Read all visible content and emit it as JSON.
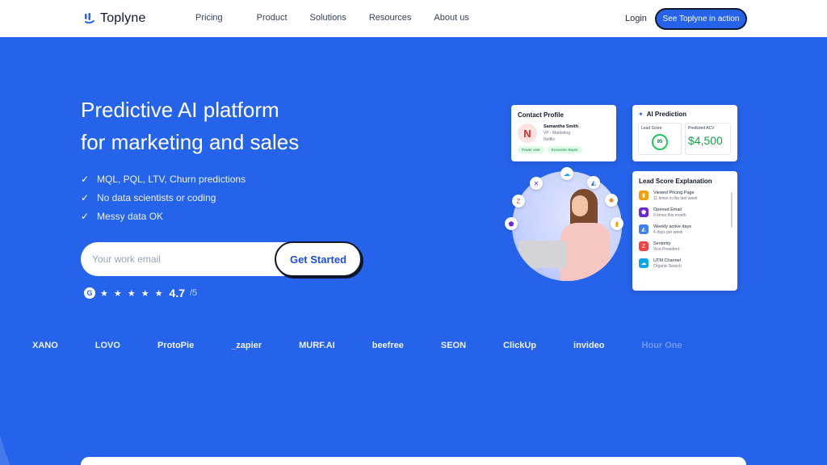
{
  "nav": {
    "logo_text": "Toplyne",
    "links": [
      "Pricing",
      "Product",
      "Solutions",
      "Resources",
      "About us"
    ],
    "login": "Login",
    "cta": "See Toplyne in action"
  },
  "hero": {
    "title_line1": "Predictive AI platform",
    "title_line2": "for marketing and sales",
    "checks": [
      "MQL, PQL, LTV, Churn predictions",
      "No data scientists or coding",
      "Messy data OK"
    ],
    "email_placeholder": "Your work email",
    "cta": "Get Started",
    "rating_badge": "G",
    "stars": "★ ★ ★ ★ ★",
    "score": "4.7",
    "score_denom": "/5"
  },
  "contact_card": {
    "title": "Contact Profile",
    "avatar_letter": "N",
    "name": "Samantha Smith",
    "role": "VP - Marketing",
    "company": "Netflix",
    "tags": [
      "Power user",
      "Economic Buyer"
    ]
  },
  "prediction_card": {
    "title": "AI Prediction",
    "lead_score_label": "Lead Score",
    "lead_score": "95",
    "acv_label": "Predicted ACV",
    "acv": "$4,500"
  },
  "lead_explanation": {
    "title": "Lead Score Explanation",
    "items": [
      {
        "title": "Viewed Pricing Page",
        "sub": "11 times in the last week",
        "color": "#f59e0b"
      },
      {
        "title": "Opened Email",
        "sub": "6 times this month",
        "color": "#6d28d9"
      },
      {
        "title": "Weekly active days",
        "sub": "4 days per week",
        "color": "#3b82f6"
      },
      {
        "title": "Seniority",
        "sub": "Vice President",
        "color": "#ef4444"
      },
      {
        "title": "UTM Channel",
        "sub": "Organic Search",
        "color": "#0ea5e9"
      }
    ]
  },
  "brands": [
    "XANO",
    "LOVO",
    "ProtoPie",
    "_zapier",
    "MURF.AI",
    "beefree",
    "SEON",
    "ClickUp",
    "invideo",
    "Hour One"
  ],
  "colors": {
    "background": "#2563eb",
    "accent": "#1d4ed8",
    "white": "#ffffff",
    "dark": "#0f172a",
    "success": "#16a34a"
  }
}
